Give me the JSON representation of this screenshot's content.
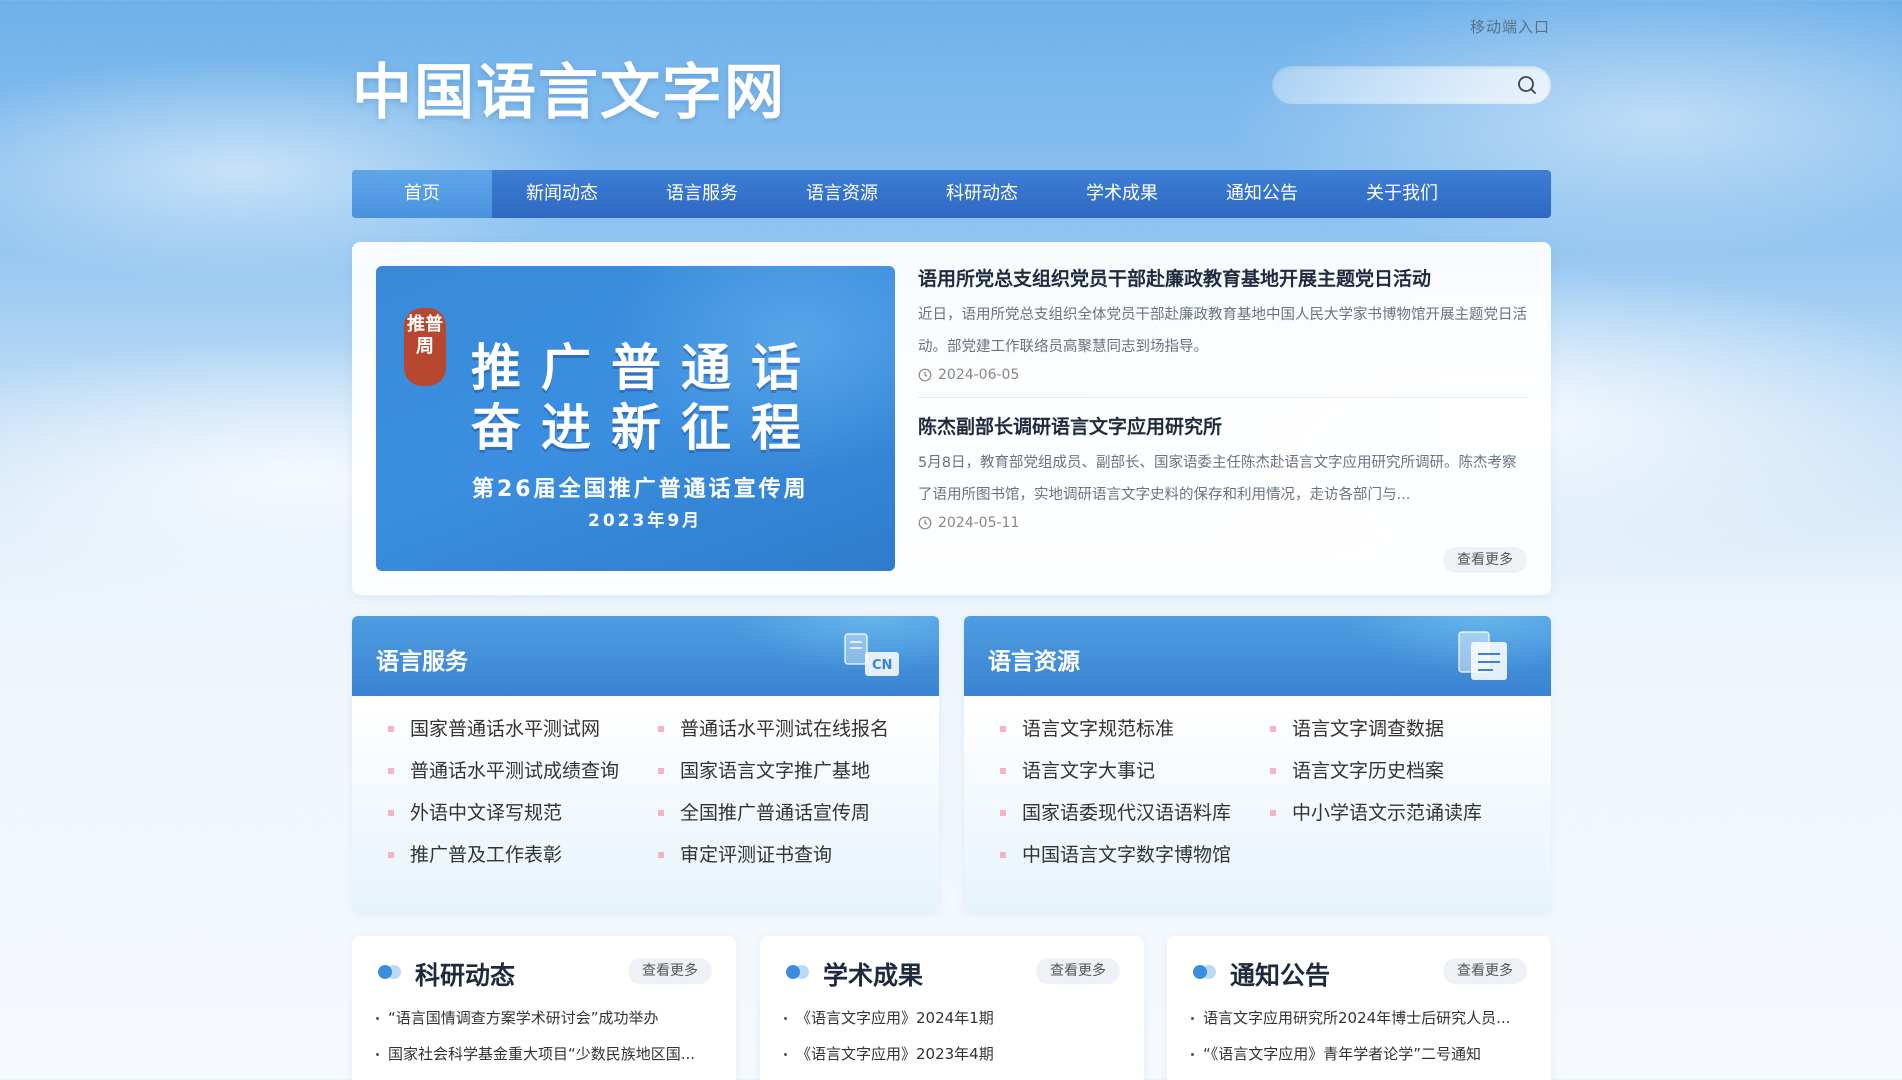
{
  "header": {
    "mobile_link": "移动端入口",
    "logo": "中国语言文字网",
    "search_placeholder": ""
  },
  "nav": {
    "items": [
      "首页",
      "新闻动态",
      "语言服务",
      "语言资源",
      "科研动态",
      "学术成果",
      "通知公告",
      "关于我们"
    ],
    "active": "首页"
  },
  "banner": {
    "stamp": "推普周",
    "line1": "推广普通话",
    "line2": "奋进新征程",
    "subtitle": "第26届全国推广普通话宣传周",
    "date": "2023年9月"
  },
  "news": {
    "items": [
      {
        "title": "语用所党总支组织党员干部赴廉政教育基地开展主题党日活动",
        "summary": "近日，语用所党总支组织全体党员干部赴廉政教育基地中国人民大学家书博物馆开展主题党日活动。部党建工作联络员高聚慧同志到场指导。",
        "date": "2024-06-05"
      },
      {
        "title": "陈杰副部长调研语言文字应用研究所",
        "summary": "5月8日，教育部党组成员、副部长、国家语委主任陈杰赴语言文字应用研究所调研。陈杰考察了语用所图书馆，实地调研语言文字史料的保存和利用情况，走访各部门与...",
        "date": "2024-05-11"
      }
    ],
    "more": "查看更多"
  },
  "panels": {
    "service": {
      "title": "语言服务",
      "icon": "translate-cn-icon",
      "links": [
        "国家普通话水平测试网",
        "普通话水平测试在线报名",
        "普通话水平测试成绩查询",
        "国家语言文字推广基地",
        "外语中文译写规范",
        "全国推广普通话宣传周",
        "推广普及工作表彰",
        "审定评测证书查询"
      ]
    },
    "resource": {
      "title": "语言资源",
      "icon": "document-resource-icon",
      "links": [
        "语言文字规范标准",
        "语言文字调查数据",
        "语言文字大事记",
        "语言文字历史档案",
        "国家语委现代汉语语料库",
        "中小学语文示范诵读库",
        "中国语言文字数字博物馆"
      ]
    }
  },
  "bottom": {
    "research": {
      "title": "科研动态",
      "more": "查看更多",
      "items": [
        "“语言国情调查方案学术研讨会”成功举办",
        "国家社会科学基金重大项目“少数民族地区国..."
      ]
    },
    "academic": {
      "title": "学术成果",
      "more": "查看更多",
      "items": [
        "《语言文字应用》2024年1期",
        "《语言文字应用》2023年4期"
      ]
    },
    "notice": {
      "title": "通知公告",
      "more": "查看更多",
      "items": [
        "语言文字应用研究所2024年博士后研究人员...",
        "“《语言文字应用》青年学者论学”二号通知"
      ]
    }
  },
  "colors": {
    "nav_bg": "#2f68c2",
    "nav_active": "#4a92de",
    "panel_head": "#3b83d2",
    "stamp": "#b8472f"
  }
}
